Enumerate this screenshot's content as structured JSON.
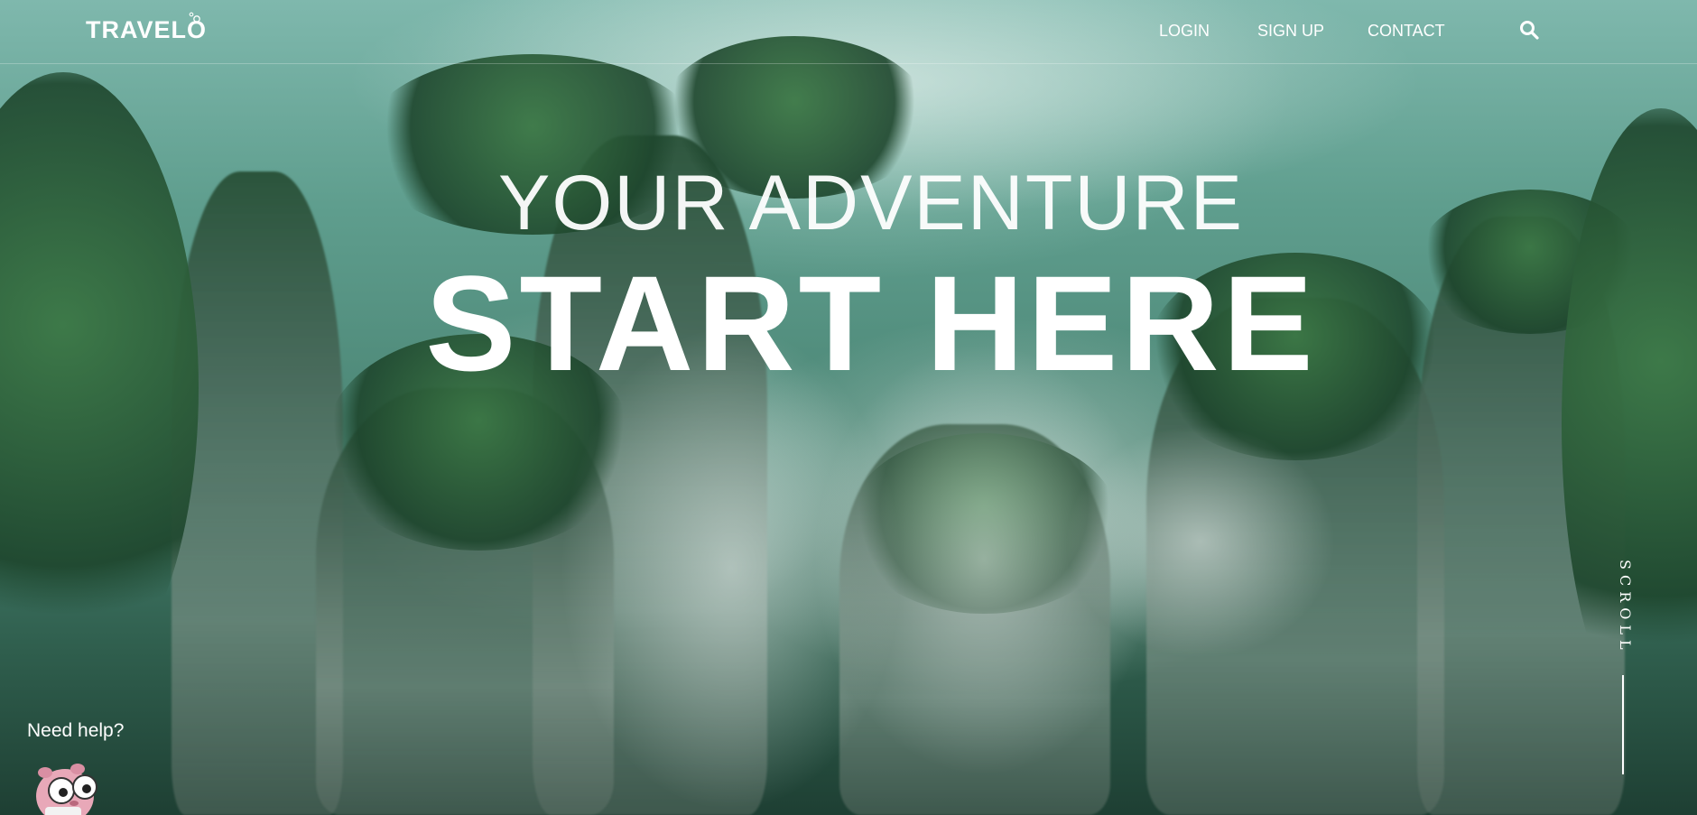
{
  "brand": {
    "logo_text": "TRAVELO"
  },
  "nav": {
    "login": "LOGIN",
    "signup": "SIGN UP",
    "contact": "CONTACT"
  },
  "hero": {
    "headline_small": "YOUR ADVENTURE",
    "headline_big": "START HERE"
  },
  "scroll": {
    "label": "SCROLL"
  },
  "help": {
    "label": "Need help?"
  },
  "icons": {
    "search": "search-icon",
    "mascot": "help-mascot-icon"
  },
  "colors": {
    "text": "#ffffff",
    "sky": "#7fb8ad",
    "forest": "#2f5e4d"
  }
}
